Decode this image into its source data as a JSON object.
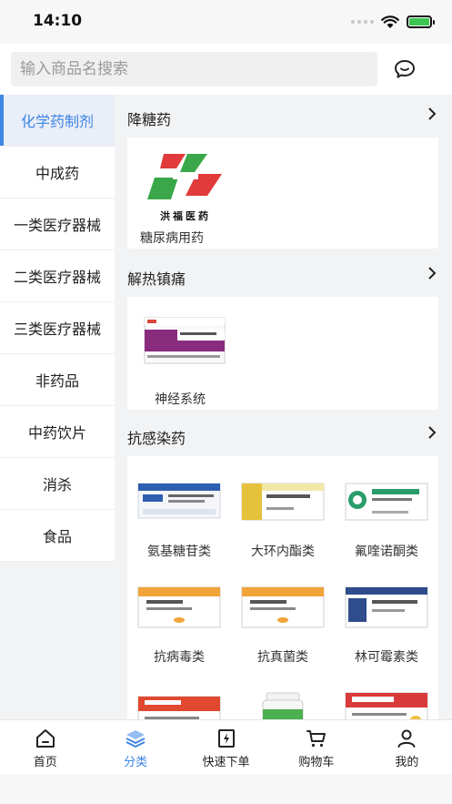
{
  "status_bar": {
    "time": "14:10"
  },
  "search": {
    "placeholder": "输入商品名搜索"
  },
  "sidebar": {
    "items": [
      {
        "label": "化学药制剂",
        "active": true
      },
      {
        "label": "中成药"
      },
      {
        "label": "一类医疗器械"
      },
      {
        "label": "二类医疗器械"
      },
      {
        "label": "三类医疗器械"
      },
      {
        "label": "非药品"
      },
      {
        "label": "中药饮片"
      },
      {
        "label": "消杀"
      },
      {
        "label": "食品"
      }
    ]
  },
  "sections": [
    {
      "title": "降糖药",
      "items": [
        {
          "label": "糖尿病用药",
          "logo_text": "洪福医药"
        }
      ]
    },
    {
      "title": "解热镇痛",
      "items": [
        {
          "label": "神经系统"
        }
      ]
    },
    {
      "title": "抗感染药",
      "items": [
        {
          "label": "氨基糖苷类"
        },
        {
          "label": "大环内酯类"
        },
        {
          "label": "氟喹诺酮类"
        },
        {
          "label": "抗病毒类"
        },
        {
          "label": "抗真菌类"
        },
        {
          "label": "林可霉素类"
        }
      ]
    }
  ],
  "tabbar": {
    "items": [
      {
        "label": "首页",
        "icon": "home-icon"
      },
      {
        "label": "分类",
        "icon": "layers-icon",
        "active": true
      },
      {
        "label": "快速下单",
        "icon": "quick-order-icon"
      },
      {
        "label": "购物车",
        "icon": "cart-icon"
      },
      {
        "label": "我的",
        "icon": "user-icon"
      }
    ]
  },
  "colors": {
    "accent": "#3e86e6",
    "sidebar_active_bg": "#e9eef8",
    "background": "#f2f3f5"
  }
}
